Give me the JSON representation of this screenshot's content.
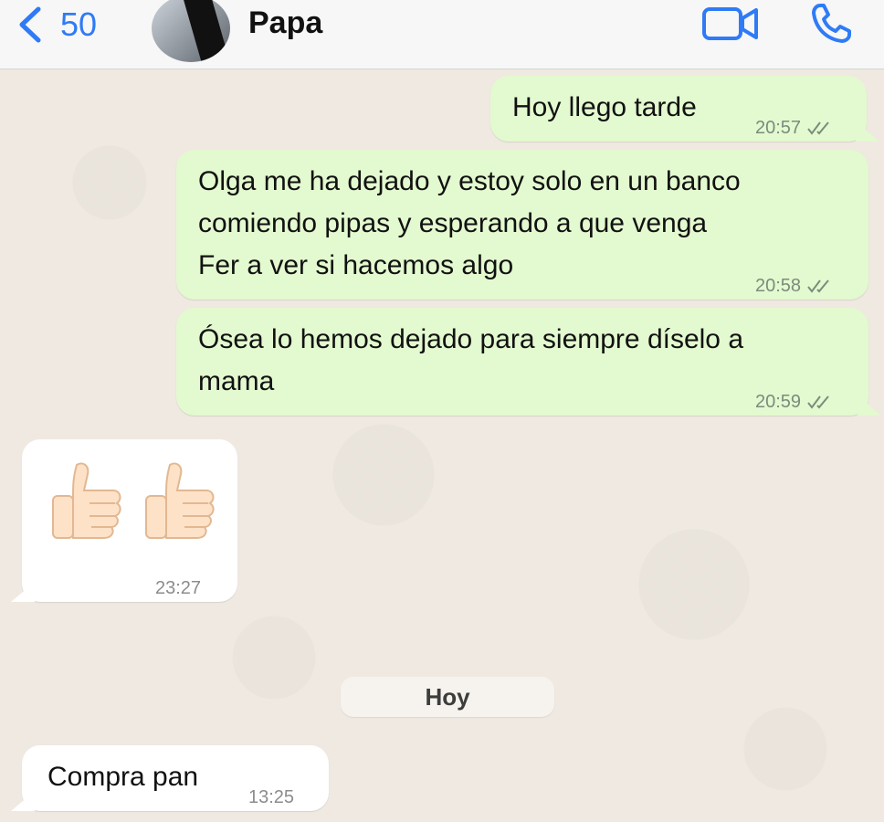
{
  "header": {
    "back_count": "50",
    "contact_name": "Papa",
    "back_icon": "chevron-left-icon",
    "video_icon": "video-camera-icon",
    "call_icon": "phone-icon",
    "accent_color": "#2f7bf6"
  },
  "messages": [
    {
      "direction": "outgoing",
      "text": "Hoy llego tarde",
      "time": "20:57",
      "status": "read"
    },
    {
      "direction": "outgoing",
      "lines": [
        "Olga me ha dejado y estoy solo en un banco",
        "comiendo pipas y esperando a que venga",
        "Fer a ver si hacemos algo"
      ],
      "time": "20:58",
      "status": "read"
    },
    {
      "direction": "outgoing",
      "lines": [
        "Ósea lo hemos dejado para siempre díselo a",
        "mama"
      ],
      "time": "20:59",
      "status": "read"
    },
    {
      "direction": "incoming",
      "content": "thumbs-up-emoji x2",
      "time": "23:27"
    },
    {
      "direction": "incoming",
      "text": "Compra pan",
      "time": "13:25"
    }
  ],
  "date_separator": "Hoy",
  "colors": {
    "outgoing_bubble": "#e3f9cf",
    "incoming_bubble": "#ffffff",
    "chat_background": "#efe9e1"
  }
}
